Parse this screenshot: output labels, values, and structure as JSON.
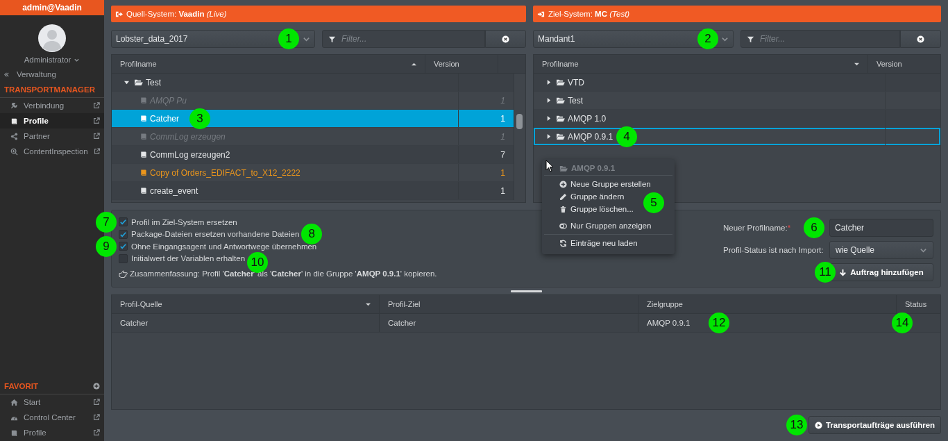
{
  "sidebar": {
    "header": "admin@Vaadin",
    "user": "Administrator",
    "back_link": "Verwaltung",
    "section": "TRANSPORTMANAGER",
    "items": [
      {
        "kind": "plug",
        "label": "Verbindung",
        "selected": false
      },
      {
        "kind": "book",
        "label": "Profile",
        "selected": true
      },
      {
        "kind": "share",
        "label": "Partner",
        "selected": false
      },
      {
        "kind": "zoom",
        "label": "ContentInspection",
        "selected": false
      }
    ],
    "favorites": {
      "title": "FAVORIT",
      "items": [
        {
          "kind": "home",
          "label": "Start",
          "selected": false
        },
        {
          "kind": "dashboard",
          "label": "Control Center",
          "selected": false
        },
        {
          "kind": "book",
          "label": "Profile",
          "selected": false
        }
      ]
    }
  },
  "source": {
    "banner": {
      "kind": "export",
      "text": "Quell-System: **Vaadin** *(Live)*"
    },
    "select": {
      "value": "Lobster_data_2017",
      "callout": "1"
    },
    "filter": {
      "placeholder": "Filter..."
    },
    "table": {
      "columns": [
        {
          "label": "Profilname",
          "sorted": true,
          "ascending": true
        },
        {
          "label": "Version"
        }
      ],
      "rows": [
        {
          "kind": "folder",
          "name": "Test",
          "expanded": true,
          "selected": false,
          "children": [
            {
              "kind": "profile",
              "name": "AMQP Pu",
              "version": "1",
              "selected": false,
              "disabled": true,
              "modified": false
            },
            {
              "kind": "profile",
              "name": "Catcher",
              "version": "1",
              "selected": true,
              "disabled": false,
              "modified": false,
              "callout": "3"
            },
            {
              "kind": "profile",
              "name": "CommLog erzeugen",
              "version": "1",
              "selected": false,
              "disabled": true,
              "modified": false
            },
            {
              "kind": "profile",
              "name": "CommLog erzeugen2",
              "version": "7",
              "selected": false,
              "disabled": false,
              "modified": false
            },
            {
              "kind": "profile",
              "name": "Copy of Orders_EDIFACT_to_X12_2222",
              "version": "1",
              "selected": false,
              "disabled": false,
              "modified": true
            },
            {
              "kind": "profile",
              "name": "create_event",
              "version": "1",
              "selected": false,
              "disabled": false,
              "modified": false
            }
          ]
        }
      ]
    }
  },
  "target": {
    "banner": {
      "kind": "import",
      "text": "Ziel-System: **MC** *(Test)*"
    },
    "select": {
      "value": "Mandant1",
      "callout": "2"
    },
    "filter": {
      "placeholder": "Filter..."
    },
    "table": {
      "columns": [
        {
          "label": "Profilname",
          "sorted": true,
          "ascending": false
        },
        {
          "label": "Version"
        }
      ],
      "rows": [
        {
          "kind": "folder",
          "name": "VTD",
          "expanded": false,
          "selected": false
        },
        {
          "kind": "folder",
          "name": "Test",
          "expanded": false,
          "selected": false
        },
        {
          "kind": "folder",
          "name": "AMQP 1.0",
          "expanded": false,
          "selected": false
        },
        {
          "kind": "folder",
          "name": "AMQP 0.9.1",
          "expanded": false,
          "selected": true,
          "callout": "4"
        }
      ]
    },
    "context_menu": {
      "title": "AMQP 0.9.1",
      "callout": "5",
      "groups": [
        [
          {
            "kind": "plus",
            "label": "Neue Gruppe erstellen"
          },
          {
            "kind": "pencil",
            "label": "Gruppe ändern"
          },
          {
            "kind": "trash",
            "label": "Gruppe löschen..."
          }
        ],
        [
          {
            "kind": "toggle",
            "label": "Nur Gruppen anzeigen"
          }
        ],
        [
          {
            "kind": "refresh",
            "label": "Einträge neu laden"
          }
        ]
      ]
    }
  },
  "options": {
    "checkboxes": [
      {
        "label": "Profil im Ziel-System ersetzen",
        "checked": true,
        "callout": "7"
      },
      {
        "label": "Package-Dateien ersetzen vorhandene Dateien",
        "checked": true,
        "callout": "8"
      },
      {
        "label": "Ohne Eingangsagent und Antwortwege übernehmen",
        "checked": true,
        "callout": "9"
      },
      {
        "label": "Initialwert der Variablen erhalten",
        "checked": false,
        "callout": "10"
      }
    ],
    "summary": "Zusammenfassung: Profil '**Catcher**' als '**Catcher**' in die Gruppe '**AMQP 0.9.1**' kopieren.",
    "new_name": {
      "label": "Neuer Profilname:",
      "required_mark": "*",
      "value": "Catcher",
      "callout": "6"
    },
    "status": {
      "label": "Profil-Status ist nach Import:",
      "value": "wie Quelle"
    },
    "add_button": {
      "label": "Auftrag hinzufügen",
      "callout": "11"
    }
  },
  "jobs": {
    "columns": [
      {
        "label": "Profil-Quelle",
        "sorted": true,
        "ascending": false
      },
      {
        "label": "Profil-Ziel"
      },
      {
        "label": "Zielgruppe"
      },
      {
        "label": "Status"
      }
    ],
    "rows": [
      {
        "source": "Catcher",
        "target": "Catcher",
        "group": "AMQP 0.9.1",
        "group_callout": "12",
        "status_callout": "14"
      }
    ]
  },
  "execute_button": {
    "label": "Transportaufträge ausführen",
    "callout": "13"
  }
}
